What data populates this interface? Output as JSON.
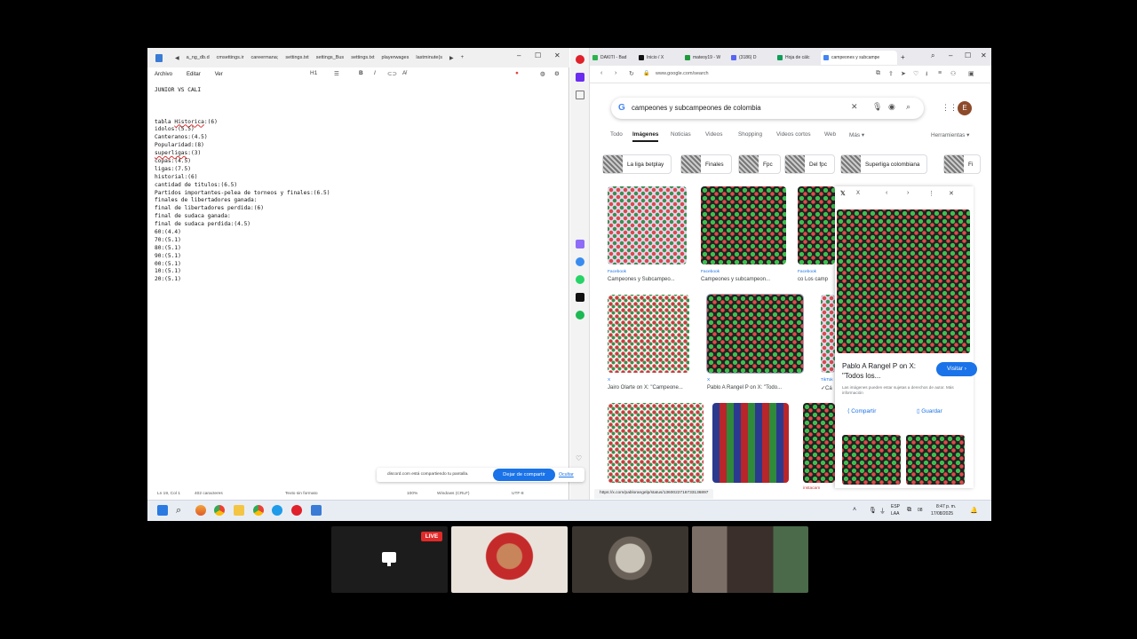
{
  "notepad": {
    "tabs": [
      "a_ng_db.d",
      "cmsettings.ir",
      "careermana;",
      "settings.txt",
      "settings_Bus",
      "settings.txt",
      "playerwages",
      "lastminute(s"
    ],
    "menu": [
      "Archivo",
      "Editar",
      "Ver"
    ],
    "heading_tool": "H1",
    "lines": [
      "JUNIOR VS CALI",
      "",
      "",
      "",
      "tabla Historica:(6)",
      "idolos:(5.5)",
      "Canteranos:(4.5)",
      "Popularidad:(8)",
      "superligas:(3)",
      "copas:(4.5)",
      "ligas:(7.5)",
      "historial:(6)",
      "cantidad de titulos:(6.5)",
      "Partidos importantes-pelea de torneos y finales:(6.5)",
      "finales de libertadores ganada:",
      "final de libertadores perdida:(6)",
      "final de sudaca ganada:",
      "final de sudaca perdida:(4.5)",
      "60:(4.4)",
      "70:(5.1)",
      "80:(5.1)",
      "90:(5.1)",
      "00:(5.1)",
      "10:(5.1)",
      "20:(5.1)"
    ],
    "status": {
      "position": "Ln 19, Col 1",
      "chars": "402 caracteres",
      "format": "Texto sin formato",
      "zoom": "100%",
      "eol": "Windows (CRLF)",
      "encoding": "UTF-8"
    }
  },
  "browser": {
    "tabs": [
      "DAKITI - Bad",
      "Inicio / X",
      "mateoy19 - W",
      "(3186) D",
      "Hoja de cálc",
      "campeones y subcampe"
    ],
    "url": "www.google.com/search",
    "query": "campeones y subcampeones de colombia",
    "avatar_letter": "E",
    "search_tabs": [
      "Todo",
      "Imágenes",
      "Noticias",
      "Videos",
      "Shopping",
      "Videos cortos",
      "Web",
      "Más ▾",
      "Herramientas ▾"
    ],
    "chips": [
      "La liga betplay",
      "Finales",
      "Fpc",
      "Del fpc",
      "Superliga colombiana",
      "Fi"
    ],
    "results": [
      {
        "source": "Facebook",
        "title": "Campeones y Subcampeo..."
      },
      {
        "source": "Facebook",
        "title": "Campeones y subcampeon..."
      },
      {
        "source": "Facebook",
        "title": "co Los camp"
      },
      {
        "source": "X",
        "title": "Jairo Olarte on X: \"Campeone..."
      },
      {
        "source": "X",
        "title": "Pablo A Rangel P on X: \"Todo..."
      },
      {
        "source": "TikTok",
        "title": "✓Cá"
      }
    ],
    "preview": {
      "source": "X",
      "title": "Pablo A Rangel P on X: \"Todos los...",
      "visit_label": "Visitar ›",
      "note": "Las imágenes pueden estar sujetas a derechos de autor. Más información",
      "share_label": "Compartir",
      "save_label": "Guardar"
    },
    "share_bar": {
      "message": "discord.com está compartiendo tu pantalla.",
      "stop_label": "Dejar de compartir",
      "hide_label": "Ocultar"
    },
    "status_url": "https://x.com/pablorangelp/status/1360022716733136897",
    "instacart_label": "instacam"
  },
  "taskbar": {
    "lang": "ESP",
    "region": "LAA",
    "time": "8:47 p. m.",
    "date": "17/08/2025",
    "badge": "08"
  },
  "call": {
    "live_label": "LIVE"
  },
  "colors": {
    "accent": "#1a73e8",
    "live": "#e02a2a"
  }
}
